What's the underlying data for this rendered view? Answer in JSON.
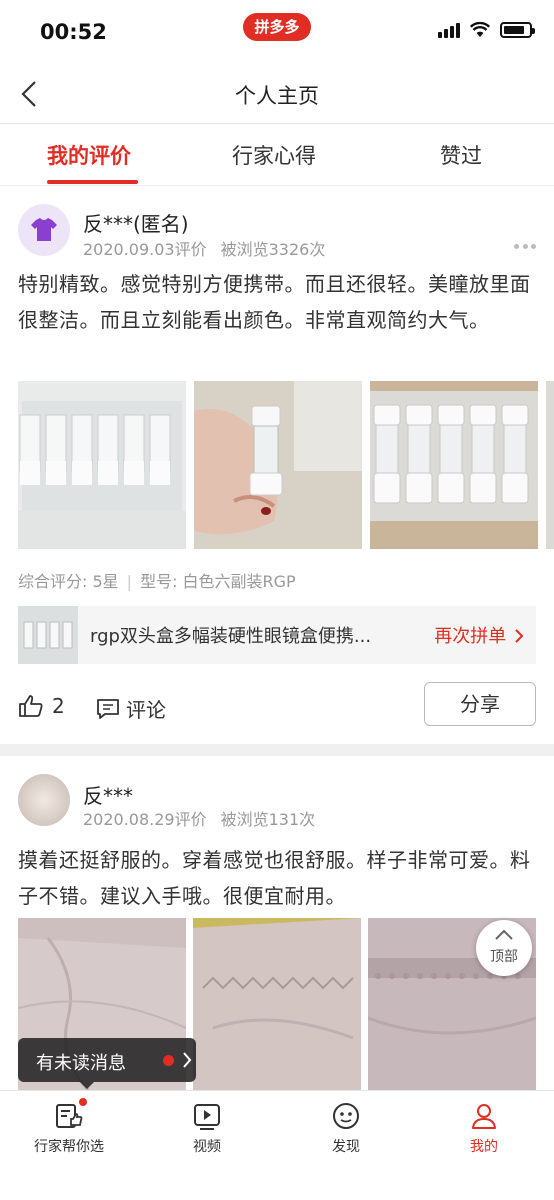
{
  "status_bar": {
    "time": "00:52",
    "app_badge": "拼多多"
  },
  "nav": {
    "title": "个人主页"
  },
  "tabs": [
    {
      "label": "我的评价",
      "active": true
    },
    {
      "label": "行家心得",
      "active": false
    },
    {
      "label": "赞过",
      "active": false
    }
  ],
  "reviews": [
    {
      "user": "反***(匿名)",
      "date": "2020.09.03评价",
      "views": "被浏览3326次",
      "text": "特别精致。感觉特别方便携带。而且还很轻。美瞳放里面很整洁。而且立刻能看出颜色。非常直观简约大气。",
      "summary_rating": "综合评分: 5星",
      "summary_model": "型号: 白色六副装RGP",
      "product_name": "rgp双头盒多幅装硬性眼镜盒便携...",
      "rebuy_label": "再次拼单",
      "likes": "2",
      "comment_label": "评论",
      "share_label": "分享"
    },
    {
      "user": "反***",
      "date": "2020.08.29评价",
      "views": "被浏览131次",
      "text": "摸着还挺舒服的。穿着感觉也很舒服。样子非常可爱。料子不错。建议入手哦。很便宜耐用。"
    }
  ],
  "floating": {
    "top_label": "顶部",
    "unread_label": "有未读消息"
  },
  "bottom_nav": [
    {
      "label": "行家帮你选",
      "icon": "expert-pick-icon",
      "badge": true
    },
    {
      "label": "视频",
      "icon": "video-icon"
    },
    {
      "label": "发现",
      "icon": "discover-icon"
    },
    {
      "label": "我的",
      "icon": "profile-icon",
      "active": true
    }
  ],
  "colors": {
    "accent": "#e02e24",
    "muted_text": "#999999",
    "avatar_bg": "#ede4f7",
    "avatar_icon": "#8a3fd1"
  }
}
